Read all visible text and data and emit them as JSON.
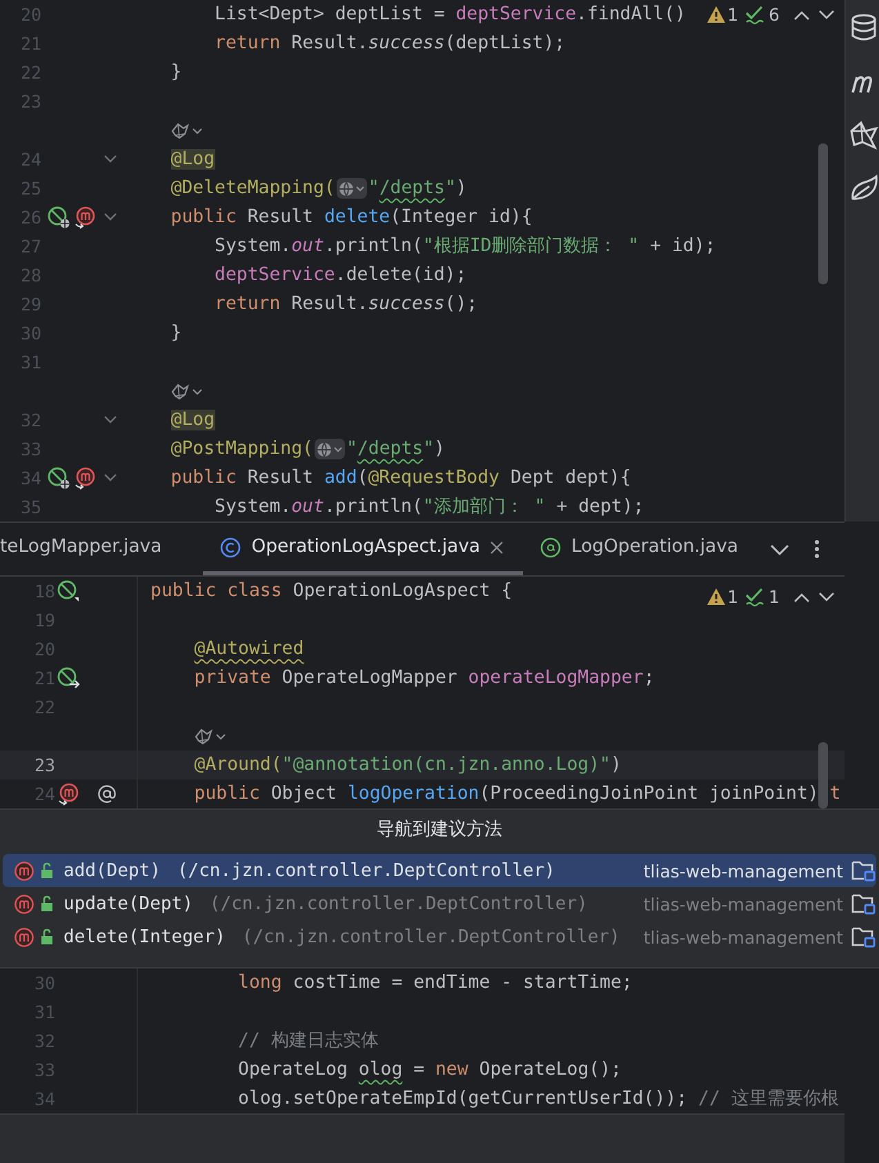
{
  "editor_top": {
    "inspections": {
      "warnings": "1",
      "checks": "6"
    },
    "lines": [
      {
        "kind": "code",
        "number": "20",
        "current": false,
        "tokens": [
          {
            "t": "        List<Dept> deptList = ",
            "kind": "plain"
          },
          {
            "t": "deptService",
            "kind": "field"
          },
          {
            "t": ".findAll()",
            "kind": "plain"
          }
        ]
      },
      {
        "kind": "code",
        "number": "21",
        "current": false,
        "tokens": [
          {
            "t": "        return",
            "kind": "keyword"
          },
          {
            "t": " Result.",
            "kind": "plain"
          },
          {
            "t": "success",
            "kind": "static-call"
          },
          {
            "t": "(deptList);",
            "kind": "plain"
          }
        ]
      },
      {
        "kind": "code",
        "number": "22",
        "current": false,
        "tokens": [
          {
            "t": "    }",
            "kind": "plain"
          }
        ]
      },
      {
        "kind": "code",
        "number": "23",
        "current": false
      },
      {
        "kind": "hint"
      },
      {
        "kind": "code",
        "number": "24",
        "current": false,
        "fold": true,
        "tokens": [
          {
            "t": "    @Log",
            "kind": "annotation",
            "highlight": true
          }
        ]
      },
      {
        "kind": "code",
        "number": "25",
        "current": false,
        "tokens": [
          {
            "t": "    @DeleteMapping(",
            "kind": "annotation"
          },
          {
            "kind": "globe"
          },
          {
            "t": "\"",
            "kind": "string"
          },
          {
            "t": "/depts",
            "kind": "string",
            "spellcheck": true
          },
          {
            "t": "\"",
            "kind": "string"
          },
          {
            "t": ")",
            "kind": "plain"
          }
        ]
      },
      {
        "kind": "code",
        "number": "26",
        "current": false,
        "fold": true,
        "gutter": [
          {
            "kind": "bean-web"
          },
          {
            "kind": "mapping"
          }
        ],
        "tokens": [
          {
            "t": "    public",
            "kind": "keyword"
          },
          {
            "t": " Result ",
            "kind": "plain"
          },
          {
            "t": "delete",
            "kind": "declaration"
          },
          {
            "t": "(Integer id){",
            "kind": "plain"
          }
        ]
      },
      {
        "kind": "code",
        "number": "27",
        "current": false,
        "tokens": [
          {
            "t": "        System.",
            "kind": "plain"
          },
          {
            "t": "out",
            "kind": "static-field"
          },
          {
            "t": ".println(",
            "kind": "plain"
          },
          {
            "t": "\"根据ID删除部门数据： \"",
            "kind": "string"
          },
          {
            "t": " + id);",
            "kind": "plain"
          }
        ]
      },
      {
        "kind": "code",
        "number": "28",
        "current": false,
        "tokens": [
          {
            "t": "        deptService",
            "kind": "field"
          },
          {
            "t": ".delete(id);",
            "kind": "plain"
          }
        ]
      },
      {
        "kind": "code",
        "number": "29",
        "current": false,
        "tokens": [
          {
            "t": "        return",
            "kind": "keyword"
          },
          {
            "t": " Result.",
            "kind": "plain"
          },
          {
            "t": "success",
            "kind": "static-call"
          },
          {
            "t": "();",
            "kind": "plain"
          }
        ]
      },
      {
        "kind": "code",
        "number": "30",
        "current": false,
        "tokens": [
          {
            "t": "    }",
            "kind": "plain"
          }
        ]
      },
      {
        "kind": "code",
        "number": "31",
        "current": false
      },
      {
        "kind": "hint"
      },
      {
        "kind": "code",
        "number": "32",
        "current": false,
        "fold": true,
        "tokens": [
          {
            "t": "    @Log",
            "kind": "annotation",
            "highlight": true
          }
        ]
      },
      {
        "kind": "code",
        "number": "33",
        "current": false,
        "tokens": [
          {
            "t": "    @PostMapping(",
            "kind": "annotation"
          },
          {
            "kind": "globe"
          },
          {
            "t": "\"",
            "kind": "string"
          },
          {
            "t": "/depts",
            "kind": "string",
            "spellcheck": true
          },
          {
            "t": "\"",
            "kind": "string"
          },
          {
            "t": ")",
            "kind": "plain"
          }
        ]
      },
      {
        "kind": "code",
        "number": "34",
        "current": false,
        "fold": true,
        "gutter": [
          {
            "kind": "bean-web"
          },
          {
            "kind": "mapping"
          }
        ],
        "tokens": [
          {
            "t": "    public",
            "kind": "keyword"
          },
          {
            "t": " Result ",
            "kind": "plain"
          },
          {
            "t": "add",
            "kind": "declaration"
          },
          {
            "t": "(",
            "kind": "plain"
          },
          {
            "t": "@RequestBody",
            "kind": "annotation"
          },
          {
            "t": " Dept dept){",
            "kind": "plain"
          }
        ]
      },
      {
        "kind": "code",
        "number": "35",
        "current": false,
        "tokens": [
          {
            "t": "        System.",
            "kind": "plain"
          },
          {
            "t": "out",
            "kind": "static-field"
          },
          {
            "t": ".println(",
            "kind": "plain"
          },
          {
            "t": "\"添加部门： \"",
            "kind": "string"
          },
          {
            "t": " + dept);",
            "kind": "plain"
          }
        ]
      }
    ]
  },
  "tool_strip": [
    {
      "kind": "database"
    },
    {
      "kind": "maven"
    },
    {
      "kind": "origami"
    },
    {
      "kind": "leaf"
    }
  ],
  "tabs": [
    {
      "label": "teLogMapper.java",
      "selected": false
    },
    {
      "label": "OperationLogAspect.java",
      "kind": "class",
      "selected": true,
      "closable": true
    },
    {
      "label": "LogOperation.java",
      "kind": "annotation",
      "selected": false
    }
  ],
  "editor_bottom": {
    "inspections": {
      "warnings": "1",
      "checks": "1"
    },
    "lines": [
      {
        "kind": "code",
        "number": "18",
        "current": false,
        "gutter": [
          {
            "kind": "bean"
          }
        ],
        "tokens": [
          {
            "t": "public",
            "kind": "keyword"
          },
          {
            "t": " class",
            "kind": "keyword"
          },
          {
            "t": " OperationLogAspect {",
            "kind": "plain"
          }
        ]
      },
      {
        "kind": "code",
        "number": "19",
        "current": false
      },
      {
        "kind": "code",
        "number": "20",
        "current": false,
        "tokens": [
          {
            "t": "    @Autowired",
            "kind": "annotation",
            "warning": true
          }
        ]
      },
      {
        "kind": "code",
        "number": "21",
        "current": false,
        "gutter": [
          {
            "kind": "bean-inject"
          }
        ],
        "tokens": [
          {
            "t": "    private",
            "kind": "keyword"
          },
          {
            "t": " OperateLogMapper ",
            "kind": "plain"
          },
          {
            "t": "operateLogMapper",
            "kind": "field"
          },
          {
            "t": ";",
            "kind": "plain"
          }
        ]
      },
      {
        "kind": "code",
        "number": "22",
        "current": false
      },
      {
        "kind": "hint"
      },
      {
        "kind": "code",
        "number": "23",
        "current": true,
        "tokens": [
          {
            "t": "    @Around(",
            "kind": "annotation"
          },
          {
            "t": "\"@annotation(cn.jzn.anno.Log)\"",
            "kind": "string"
          },
          {
            "t": ")",
            "kind": "plain"
          }
        ]
      },
      {
        "kind": "code",
        "number": "24",
        "current": false,
        "gutter": [
          {
            "kind": "mapping"
          },
          {
            "kind": "at"
          }
        ],
        "tokens": [
          {
            "t": "    public",
            "kind": "keyword"
          },
          {
            "t": " Object ",
            "kind": "plain"
          },
          {
            "t": "logOperation",
            "kind": "declaration"
          },
          {
            "t": "(ProceedingJoinPoint joinPoint) ",
            "kind": "plain"
          },
          {
            "t": "t",
            "kind": "keyword"
          }
        ]
      }
    ]
  },
  "popup": {
    "title": "导航到建议方法",
    "items": [
      {
        "method": "add(Dept)",
        "location": "(/cn.jzn.controller.DeptController)",
        "module": "tlias-web-management",
        "selected": true
      },
      {
        "method": "update(Dept)",
        "location": "(/cn.jzn.controller.DeptController)",
        "module": "tlias-web-management",
        "selected": false
      },
      {
        "method": "delete(Integer)",
        "location": "(/cn.jzn.controller.DeptController)",
        "module": "tlias-web-management",
        "selected": false
      }
    ]
  },
  "editor_lower": {
    "lines": [
      {
        "kind": "code",
        "number": "30",
        "current": false,
        "tokens": [
          {
            "t": "        long",
            "kind": "keyword"
          },
          {
            "t": " costTime = endTime - startTime;",
            "kind": "plain"
          }
        ]
      },
      {
        "kind": "code",
        "number": "31",
        "current": false
      },
      {
        "kind": "code",
        "number": "32",
        "current": false,
        "tokens": [
          {
            "t": "        // 构建日志实体",
            "kind": "comment"
          }
        ]
      },
      {
        "kind": "code",
        "number": "33",
        "current": false,
        "tokens": [
          {
            "t": "        OperateLog ",
            "kind": "plain"
          },
          {
            "t": "olog",
            "kind": "plain",
            "spellcheck": true
          },
          {
            "t": " = ",
            "kind": "plain"
          },
          {
            "t": "new",
            "kind": "keyword"
          },
          {
            "t": " OperateLog();",
            "kind": "plain"
          }
        ]
      },
      {
        "kind": "code",
        "number": "34",
        "current": false,
        "tokens": [
          {
            "t": "        olog.setOperateEmpId(getCurrentUserId()); ",
            "kind": "plain"
          },
          {
            "t": "// 这里需要你根",
            "kind": "comment"
          }
        ]
      }
    ]
  }
}
